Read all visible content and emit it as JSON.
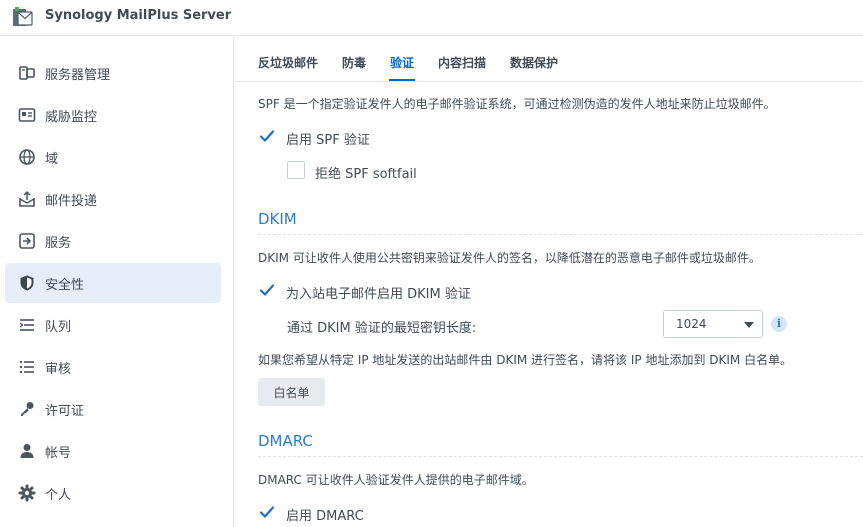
{
  "app": {
    "title": "Synology MailPlus Server"
  },
  "sidebar": {
    "items": [
      {
        "label": "服务器管理",
        "icon": "server-management-icon",
        "active": false
      },
      {
        "label": "威胁监控",
        "icon": "threat-monitor-icon",
        "active": false
      },
      {
        "label": "域",
        "icon": "globe-icon",
        "active": false
      },
      {
        "label": "邮件投递",
        "icon": "mail-delivery-icon",
        "active": false
      },
      {
        "label": "服务",
        "icon": "service-icon",
        "active": false
      },
      {
        "label": "安全性",
        "icon": "shield-icon",
        "active": true
      },
      {
        "label": "队列",
        "icon": "queue-icon",
        "active": false
      },
      {
        "label": "审核",
        "icon": "audit-list-icon",
        "active": false
      },
      {
        "label": "许可证",
        "icon": "key-icon",
        "active": false
      },
      {
        "label": "帐号",
        "icon": "user-icon",
        "active": false
      },
      {
        "label": "个人",
        "icon": "gear-icon",
        "active": false
      }
    ]
  },
  "tabs": [
    {
      "label": "反垃圾邮件",
      "active": false
    },
    {
      "label": "防毒",
      "active": false
    },
    {
      "label": "验证",
      "active": true
    },
    {
      "label": "内容扫描",
      "active": false
    },
    {
      "label": "数据保护",
      "active": false
    }
  ],
  "spf": {
    "description": "SPF 是一个指定验证发件人的电子邮件验证系统，可通过检测伪造的发件人地址来防止垃圾邮件。",
    "enable_label": "启用 SPF 验证",
    "enable_checked": true,
    "softfail_label": "拒绝 SPF softfail",
    "softfail_checked": false
  },
  "dkim": {
    "title": "DKIM",
    "description": "DKIM 可让收件人使用公共密钥来验证发件人的签名，以降低潜在的恶意电子邮件或垃圾邮件。",
    "enable_label": "为入站电子邮件启用 DKIM 验证",
    "enable_checked": true,
    "key_length_label": "通过 DKIM 验证的最短密钥长度:",
    "key_length_value": "1024",
    "whitelist_note": "如果您希望从特定 IP 地址发送的出站邮件由 DKIM 进行签名，请将该 IP 地址添加到 DKIM 白名单。",
    "whitelist_button": "白名单"
  },
  "dmarc": {
    "title": "DMARC",
    "description": "DMARC 可让收件人验证发件人提供的电子邮件域。",
    "enable_label": "启用 DMARC",
    "enable_checked": true
  },
  "colors": {
    "accent": "#0067c8",
    "section_title": "#2e7cd6",
    "checkbox": "#1c6ed1",
    "active_nav_bg": "#e6eef9"
  }
}
